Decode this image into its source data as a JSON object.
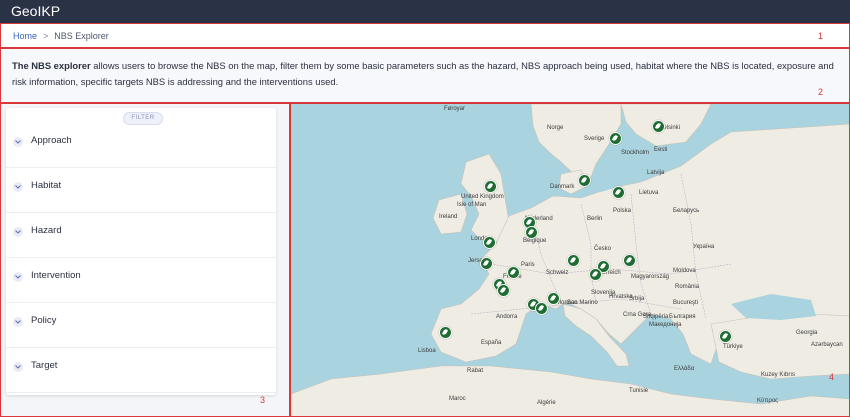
{
  "app": {
    "title": "GeoIKP"
  },
  "breadcrumb": {
    "home": "Home",
    "separator": ">",
    "current": "NBS Explorer"
  },
  "region_labels": {
    "r1": "1",
    "r2": "2",
    "r3": "3",
    "r4": "4"
  },
  "description": {
    "bold": "The NBS explorer",
    "text": " allows users to browse the NBS on the map, filter them by some basic parameters such as the hazard, NBS approach being used, habitat where the NBS is located, exposure and risk information, specific targets NBS is addressing and the interventions used."
  },
  "filter": {
    "badge": "FILTER",
    "items": [
      "Approach",
      "Habitat",
      "Hazard",
      "Intervention",
      "Policy",
      "Target"
    ]
  },
  "map": {
    "labels": [
      "Føroyar",
      "Norge",
      "Sverige",
      "Stockholm",
      "Helsinki",
      "Eesti",
      "Latvija",
      "Danmark",
      "Lietuva",
      "United Kingdom",
      "Isle of Man",
      "Ireland",
      "Nederland",
      "Berlin",
      "Polska",
      "Беларусь",
      "London",
      "Belgique",
      "Česko",
      "Україна",
      "Jersey",
      "Paris",
      "France",
      "Schweiz",
      "Österreich",
      "Magyarország",
      "Moldova",
      "Slovenija",
      "România",
      "Hrvatska",
      "Srbija",
      "Bucureşti",
      "Andorra",
      "Monaco",
      "San Marino",
      "Crna Gora",
      "Shqipëria",
      "България",
      "Македонија",
      "España",
      "Lisboa",
      "Türkiye",
      "Ελλάδα",
      "Rabat",
      "Maroc",
      "Algérie",
      "Tunisie",
      "Κύπρος",
      "Georgia",
      "Azərbaycan",
      "Kuzey Kıbrıs"
    ],
    "marker_count": 20,
    "marker_icon": "leaf-icon",
    "water_color": "#a9d3de",
    "land_color": "#efece4"
  }
}
